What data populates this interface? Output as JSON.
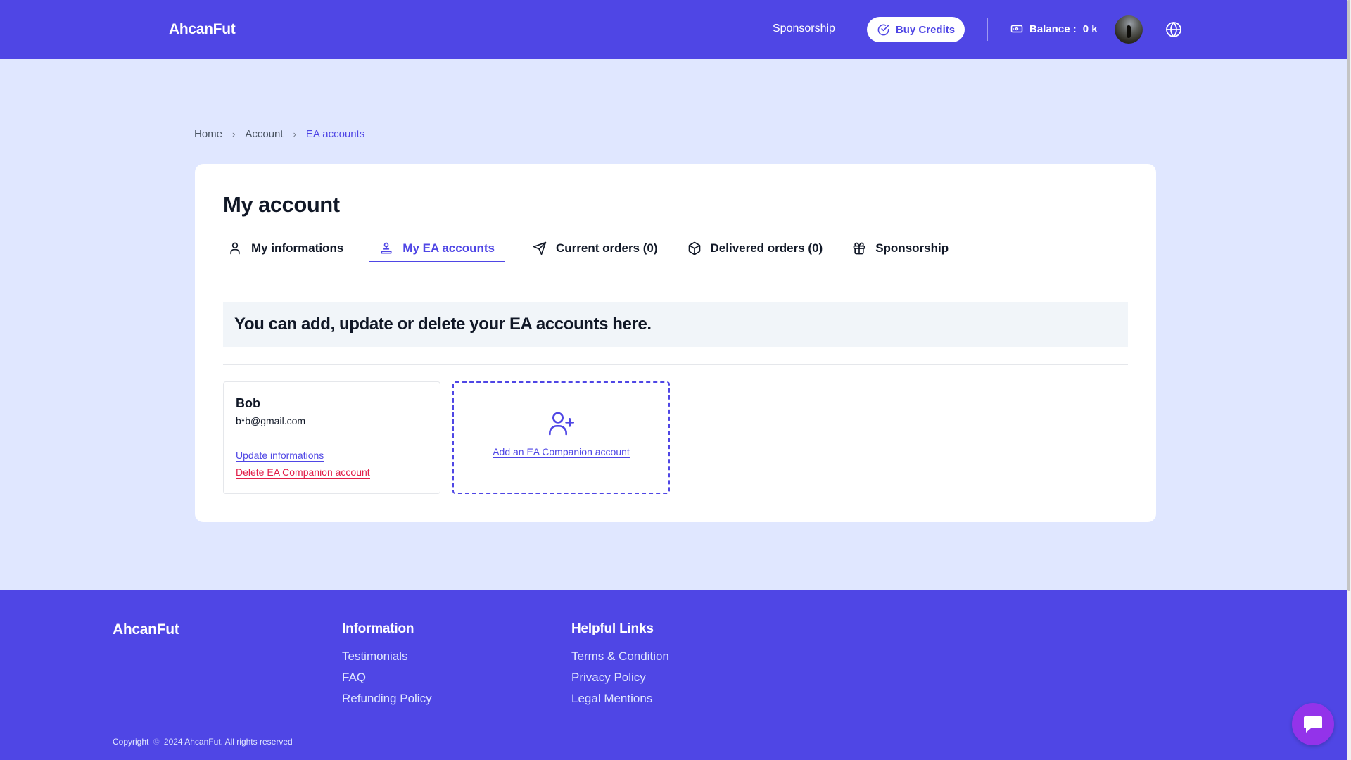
{
  "header": {
    "brand": "AhcanFut",
    "sponsorship": "Sponsorship",
    "buy_credits": "Buy Credits",
    "balance_label": "Balance :",
    "balance_value": "0 k"
  },
  "breadcrumb": {
    "items": [
      "Home",
      "Account",
      "EA accounts"
    ]
  },
  "card": {
    "title": "My account",
    "tabs": [
      {
        "label": "My informations",
        "icon": "user-icon"
      },
      {
        "label": "My EA accounts",
        "icon": "account-stack-icon"
      },
      {
        "label": "Current orders (0)",
        "icon": "send-icon"
      },
      {
        "label": "Delivered orders (0)",
        "icon": "box-icon"
      },
      {
        "label": "Sponsorship",
        "icon": "gift-icon"
      }
    ],
    "active_tab": "My EA accounts",
    "banner": "You can add, update or delete your EA accounts here.",
    "account": {
      "name": "Bob",
      "email": "b*b@gmail.com",
      "update_link": "Update informations",
      "delete_link": "Delete EA Companion account"
    },
    "add_account": "Add an EA Companion account"
  },
  "footer": {
    "brand": "AhcanFut",
    "information": {
      "title": "Information",
      "links": [
        "Testimonials",
        "FAQ",
        "Refunding Policy"
      ]
    },
    "helpful": {
      "title": "Helpful Links",
      "links": [
        "Terms & Condition",
        "Privacy Policy",
        "Legal Mentions"
      ]
    },
    "copyright_label": "Copyright",
    "copyright_text": "2024 AhcanFut. All rights reserved"
  },
  "colors": {
    "primary": "#4f46e5",
    "page_bg": "#e0e7ff",
    "danger": "#e11d48",
    "chat": "#9333ea"
  }
}
